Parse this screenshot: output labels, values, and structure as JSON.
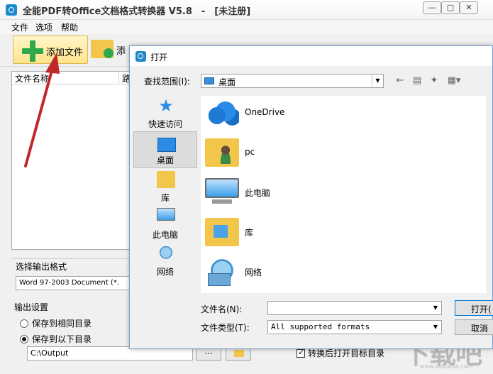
{
  "app": {
    "title": "全能PDF转Office文档格式转换器 V5.8　-　[未注册]",
    "window_buttons": {
      "minimize": "—",
      "maximize": "▢",
      "close": "✕"
    },
    "menu": [
      "文件",
      "选项",
      "帮助"
    ],
    "toolbar": {
      "add_file": "添加文件",
      "add_folder": "添"
    },
    "file_list": {
      "col_name": "文件名称",
      "col_path": "路"
    },
    "output_format": {
      "label": "选择输出格式",
      "value": "Word 97-2003 Document (*."
    },
    "output_settings": {
      "label": "输出设置",
      "same_dir": "保存到相同目录",
      "custom_dir": "保存到以下目录",
      "selected": "custom_dir",
      "path": "C:\\Output",
      "browse": "...",
      "open_after": "转换后打开目标目录",
      "open_after_checked": true
    },
    "watermark": {
      "main": "下载吧",
      "sub": "www.xiazaiba.com"
    }
  },
  "dialog": {
    "title": "打开",
    "look_in_label": "查找范围(I):",
    "look_in_value": "桌面",
    "places": [
      "快速访问",
      "桌面",
      "库",
      "此电脑",
      "网络"
    ],
    "selected_place": "桌面",
    "entries": [
      "OneDrive",
      "pc",
      "此电脑",
      "库",
      "网络"
    ],
    "filename_label": "文件名(N):",
    "filename_value": "",
    "filetype_label": "文件类型(T):",
    "filetype_value": "All supported formats",
    "open_button": "打开(",
    "cancel_button": "取消"
  },
  "colors": {
    "accent": "#1e88c8",
    "arrow": "#c0282a",
    "highlight": "#ffe48c"
  }
}
